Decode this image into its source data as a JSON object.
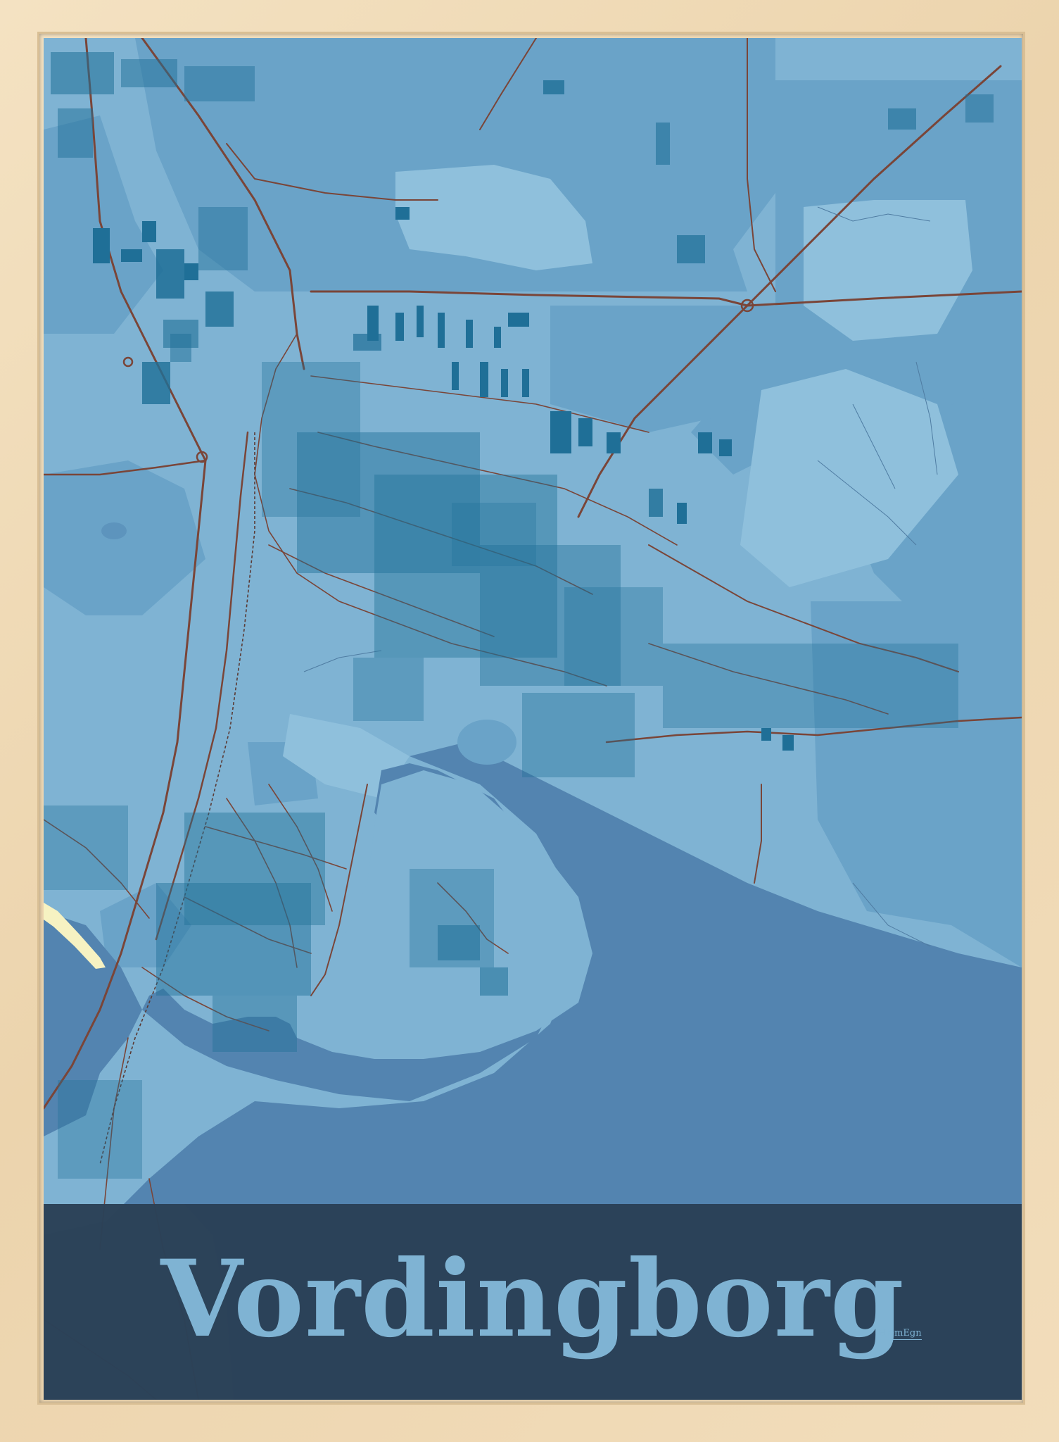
{
  "poster": {
    "title": "Vordingborg",
    "brand": "HjemEgn"
  },
  "colors": {
    "frame": "#efd9b4",
    "land_light": "#7fb3d3",
    "land_mid": "#6aa3c8",
    "water": "#5384b0",
    "buildings": "#1f6f97",
    "roads": "#7a4538",
    "title_band": "#2a4056",
    "title_text": "#7fb3d3",
    "beach": "#f6f2c2"
  },
  "icons": {
    "brand_logo": "hjemegn-wordmark"
  }
}
